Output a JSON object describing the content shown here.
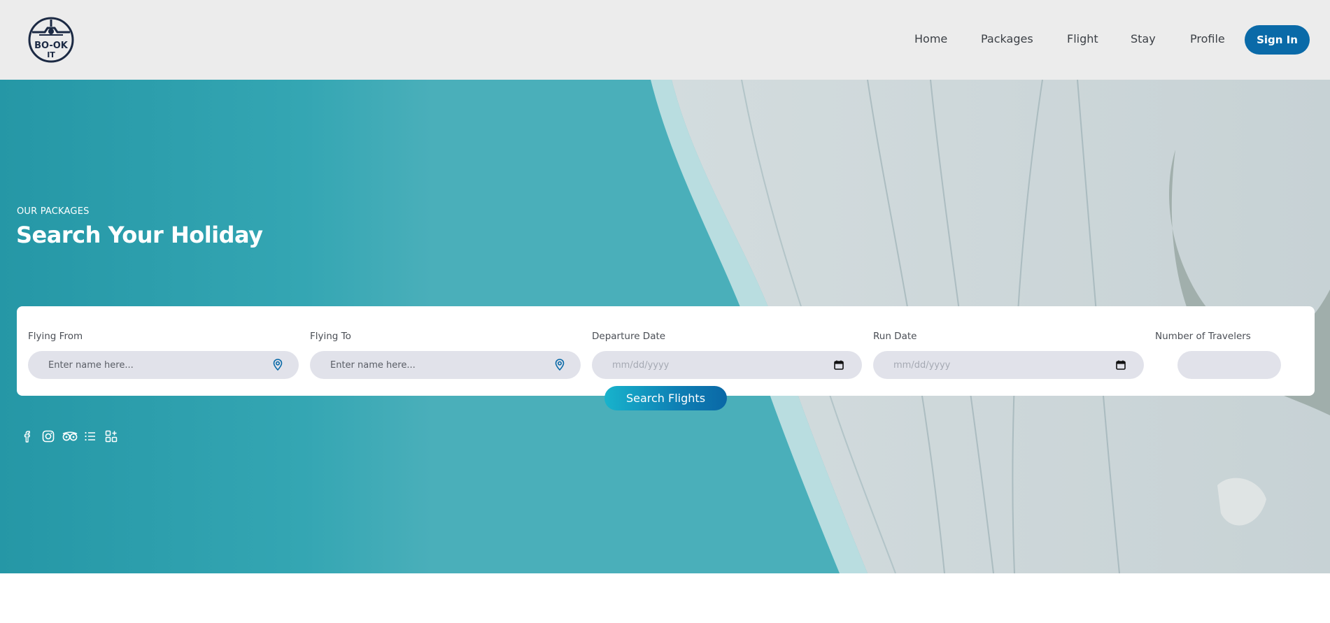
{
  "brand": {
    "logo_text_line1": "BO-OK",
    "logo_text_line2": "IT",
    "logo_color": "#1c2a44"
  },
  "nav": {
    "items": [
      {
        "label": "Home"
      },
      {
        "label": "Packages"
      },
      {
        "label": "Flight"
      },
      {
        "label": "Stay"
      },
      {
        "label": "Profile"
      }
    ],
    "signin_label": "Sign In",
    "accent": "#0a6aa8"
  },
  "hero": {
    "eyebrow": "OUR PACKAGES",
    "title": "Search Your Holiday"
  },
  "search": {
    "fields": [
      {
        "label": "Flying From",
        "placeholder": "Enter name here...",
        "icon": "map-pin-icon"
      },
      {
        "label": "Flying To",
        "placeholder": "Enter name here...",
        "icon": "map-pin-icon"
      },
      {
        "label": "Departure Date",
        "placeholder": "mm/dd/yyyy",
        "icon": "calendar-icon"
      },
      {
        "label": "Run Date",
        "placeholder": "mm/dd/yyyy",
        "icon": "calendar-icon"
      },
      {
        "label": "Number of Travelers",
        "placeholder": ""
      }
    ],
    "submit_label": "Search Flights"
  },
  "social": {
    "icons": [
      "facebook-icon",
      "instagram-icon",
      "tripadvisor-icon",
      "list-icon",
      "apps-icon"
    ]
  }
}
